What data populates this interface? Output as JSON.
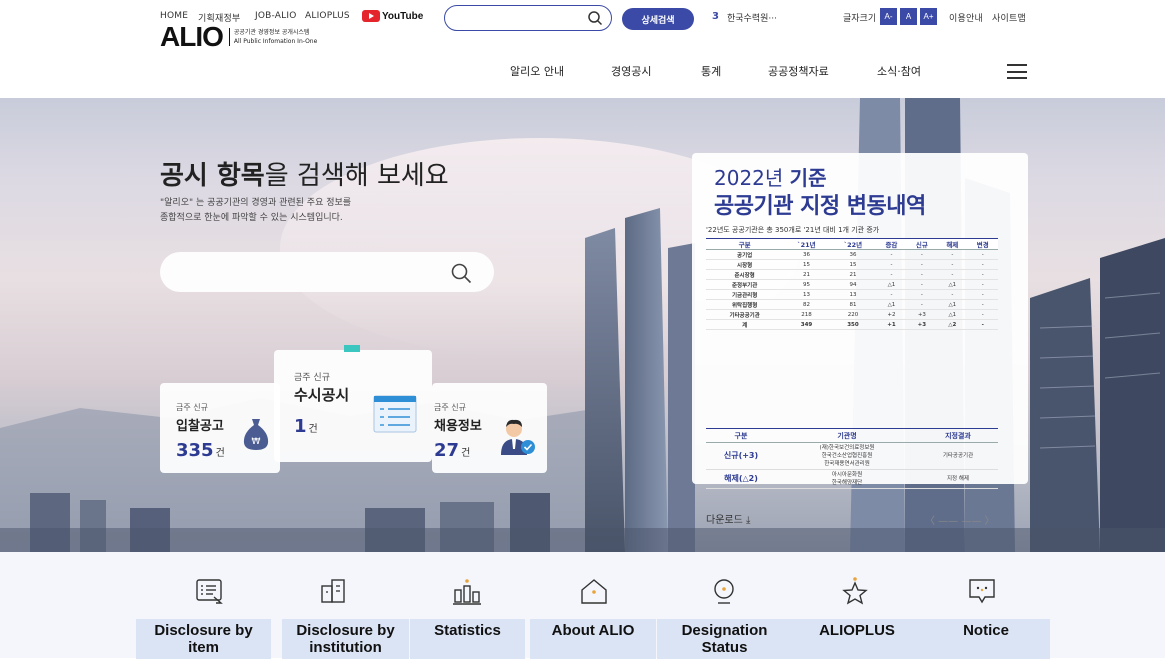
{
  "util_bar": {
    "links": [
      "HOME",
      "기획재정부",
      "JOB-ALIO",
      "ALIOPLUS"
    ],
    "youtube": "YouTube",
    "search_placeholder": "",
    "detail_search": "상세검색",
    "rank_number": "3",
    "rank_text": "한국수력원···",
    "font_size_label": "글자크기",
    "font_buttons": [
      "A-",
      "A",
      "A+"
    ],
    "guide": "이용안내",
    "sitemap": "사이트맵"
  },
  "nav": {
    "logo": "ALIO",
    "logo_sub_ko": "공공기관 경영정보 공개시스템",
    "logo_sub_en": "All Public Infomation In-One",
    "menu": [
      "알리오 안내",
      "경영공시",
      "통계",
      "공공정책자료",
      "소식·참여"
    ]
  },
  "hero": {
    "title_bold": "공시 항목",
    "title_rest": "을 검색해 보세요",
    "desc_line1": "\"알리오\" 는 공공기관의 경영과 관련된 주요 정보를",
    "desc_line2": "종합적으로 한눈에 파악할 수 있는 시스템입니다.",
    "search_placeholder": ""
  },
  "cards": [
    {
      "small": "금주 신규",
      "title": "입찰공고",
      "count": "335",
      "unit": "건"
    },
    {
      "small": "금주 신규",
      "title": "수시공시",
      "count": "1",
      "unit": "건"
    },
    {
      "small": "금주 신규",
      "title": "채용정보",
      "count": "27",
      "unit": "건"
    }
  ],
  "panel": {
    "year": "2022년",
    "year_suffix": "기준",
    "head": "공공기관 지정 변동내역",
    "note": "'22년도 공공기관은 총 350개로 '21년 대비 1개 기관 증가",
    "table_headers": [
      "구분",
      "`21년",
      "`22년",
      "증감",
      "신규",
      "해제",
      "변경"
    ],
    "table_rows": [
      [
        "공기업",
        "36",
        "36",
        "-",
        "-",
        "-",
        "-"
      ],
      [
        "시장형",
        "15",
        "15",
        "-",
        "-",
        "-",
        "-"
      ],
      [
        "준시장형",
        "21",
        "21",
        "-",
        "-",
        "-",
        "-"
      ],
      [
        "준정부기관",
        "95",
        "94",
        "△1",
        "-",
        "△1",
        "-"
      ],
      [
        "기금관리형",
        "13",
        "13",
        "-",
        "-",
        "-",
        "-"
      ],
      [
        "위탁집행형",
        "82",
        "81",
        "△1",
        "-",
        "△1",
        "-"
      ],
      [
        "기타공공기관",
        "218",
        "220",
        "+2",
        "+3",
        "△1",
        "-"
      ],
      [
        "계",
        "349",
        "350",
        "+1",
        "+3",
        "△2",
        "-"
      ]
    ],
    "table2_headers": [
      "구분",
      "기관명",
      "지정결과"
    ],
    "table2_rows": [
      {
        "label": "신규(+3)",
        "names": [
          "(재)한국보건의료정보원",
          "한국건소산업협진흥원",
          "한국재용연서관리원"
        ],
        "result": "기타공공기관"
      },
      {
        "label": "해제(△2)",
        "names": [
          "아시아문화원",
          "한국해양재단"
        ],
        "result": "지정 해제"
      }
    ],
    "download": "다운로드 ⤓",
    "pager": "〈 —— —— 〉"
  },
  "quick_menu": [
    {
      "label_line1": "Disclosure by",
      "label_line2": "item",
      "icon": "list-icon"
    },
    {
      "label_line1": "Disclosure by",
      "label_line2": "institution",
      "icon": "building-icon"
    },
    {
      "label_line1": "Statistics",
      "label_line2": "",
      "icon": "statistics-icon"
    },
    {
      "label_line1": "About ALIO",
      "label_line2": "",
      "icon": "home-icon"
    },
    {
      "label_line1": "Designation",
      "label_line2": "Status",
      "icon": "location-icon"
    },
    {
      "label_line1": "ALIOPLUS",
      "label_line2": "",
      "icon": "star-icon"
    },
    {
      "label_line1": "Notice",
      "label_line2": "",
      "icon": "speech-bubble-icon"
    }
  ],
  "colors": {
    "brand": "#2d3b92",
    "youtube": "#e5252c",
    "quick_bg": "#dbe4f4"
  }
}
